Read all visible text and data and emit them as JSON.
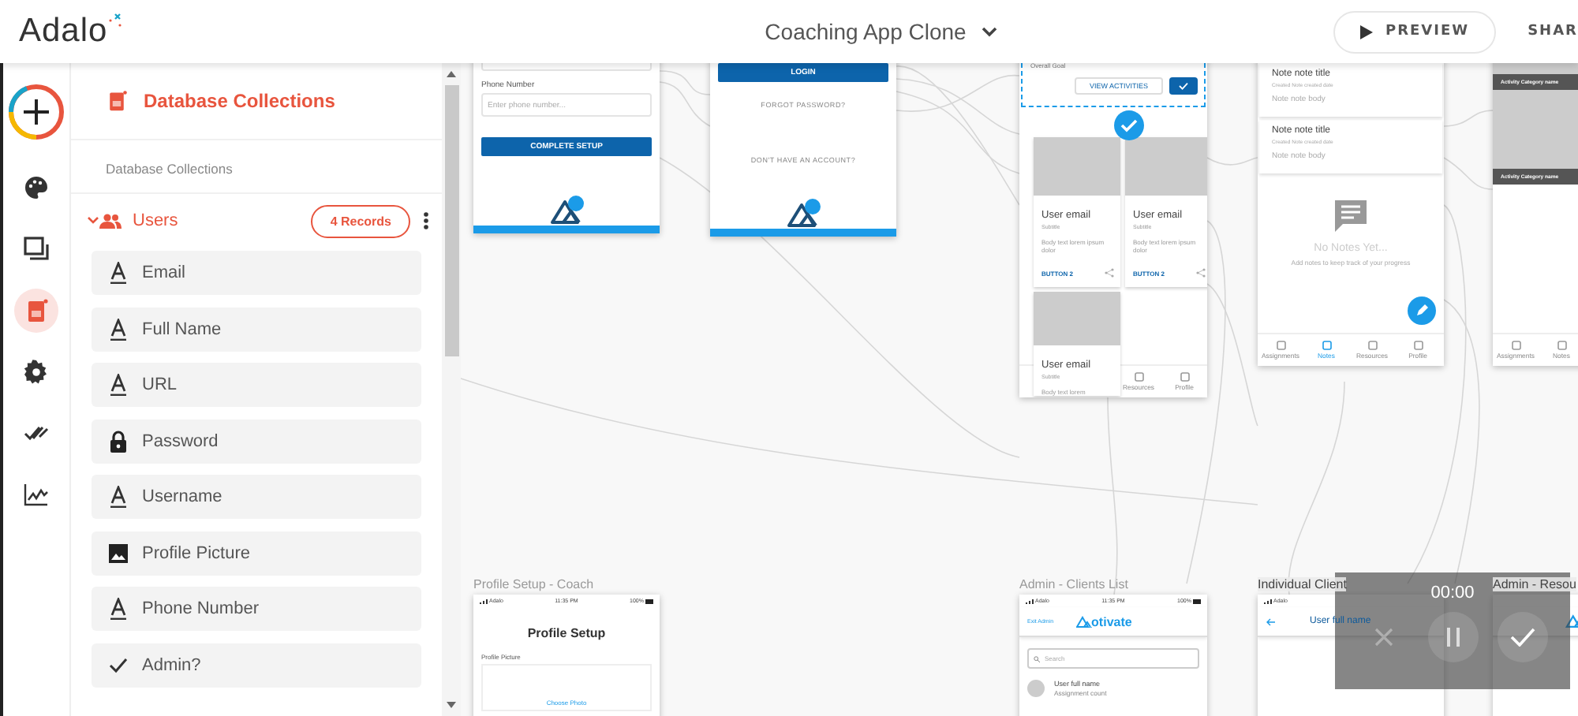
{
  "topbar": {
    "logo": "Adalo",
    "title": "Coaching App Clone",
    "preview_button": "PREVIEW",
    "share_button": "SHAR"
  },
  "rail": [
    {
      "kind": "add",
      "selected": false
    },
    {
      "kind": "branding",
      "selected": false
    },
    {
      "kind": "screens",
      "selected": false
    },
    {
      "kind": "database",
      "selected": true
    },
    {
      "kind": "settings",
      "selected": false
    },
    {
      "kind": "publish",
      "selected": false
    },
    {
      "kind": "analytics",
      "selected": false
    }
  ],
  "panel": {
    "title": "Database Collections",
    "section_label": "Database Collections",
    "collection": {
      "name": "Users",
      "records": "4 Records",
      "expanded": true
    },
    "properties": [
      {
        "kind": "text",
        "name": "Email"
      },
      {
        "kind": "text",
        "name": "Full Name"
      },
      {
        "kind": "text",
        "name": "URL"
      },
      {
        "kind": "password",
        "name": "Password"
      },
      {
        "kind": "text",
        "name": "Username"
      },
      {
        "kind": "image",
        "name": "Profile Picture"
      },
      {
        "kind": "text",
        "name": "Phone Number"
      },
      {
        "kind": "boolean",
        "name": "Admin?"
      }
    ]
  },
  "canvas": {
    "screens": [
      {
        "kind": "phone-form",
        "field_label": "Phone Number",
        "placeholder": "Enter phone number...",
        "button": "COMPLETE SETUP"
      },
      {
        "kind": "login",
        "button": "LOGIN",
        "links": [
          "FORGOT PASSWORD?",
          "DON'T HAVE AN ACCOUNT?"
        ]
      },
      {
        "kind": "activities",
        "goal_label": "Overall Goal",
        "button": "VIEW ACTIVITIES",
        "selected": true,
        "cards": [
          {
            "title": "User email",
            "subtitle": "Subtitle",
            "body": "Body text lorem ipsum dolor",
            "button": "BUTTON 2"
          },
          {
            "title": "User email",
            "subtitle": "Subtitle",
            "body": "Body text lorem ipsum dolor",
            "button": "BUTTON 2"
          },
          {
            "title": "User email",
            "subtitle": "Subtitle",
            "body": "Body text lorem"
          }
        ],
        "nav": [
          {
            "label": "Resources",
            "selected": false
          },
          {
            "label": "Profile",
            "selected": false
          }
        ]
      },
      {
        "kind": "notes",
        "notes": [
          {
            "title": "Note note title",
            "date": "Created Note created date",
            "body": "Note note body"
          },
          {
            "title": "Note note title",
            "date": "Created Note created date",
            "body": "Note note body"
          }
        ],
        "empty_title": "No Notes Yet...",
        "empty_text": "Add notes to keep track of your progress",
        "nav": [
          {
            "label": "Assignments",
            "selected": false
          },
          {
            "label": "Notes",
            "selected": true
          },
          {
            "label": "Resources",
            "selected": false
          },
          {
            "label": "Profile",
            "selected": false
          }
        ]
      },
      {
        "kind": "categories",
        "items": [
          "Activity Category name",
          "Activity Category name"
        ],
        "nav": [
          {
            "label": "Assignments",
            "selected": false
          },
          {
            "label": "Notes",
            "selected": false
          }
        ]
      },
      {
        "kind": "profile-setup",
        "label": "Profile Setup - Coach",
        "status": {
          "carrier": "Adalo",
          "time": "11:35 PM",
          "battery": "100%"
        },
        "heading": "Profile Setup",
        "field_label": "Profile Picture",
        "link": "Choose Photo"
      },
      {
        "kind": "clients-list",
        "label": "Admin - Clients List",
        "status": {
          "carrier": "Adalo",
          "time": "11:35 PM",
          "battery": "100%"
        },
        "exit": "Exit Admin",
        "logo": "otivate",
        "search": "Search",
        "clients": [
          {
            "name": "User full name",
            "detail": "Assignment count"
          }
        ]
      },
      {
        "kind": "client-detail",
        "label": "Individual Client",
        "status": {
          "carrier": "Adalo"
        },
        "title": "User full name"
      },
      {
        "kind": "resources",
        "label": "Admin - Resou"
      }
    ],
    "recorder": {
      "time": "00:00"
    }
  }
}
